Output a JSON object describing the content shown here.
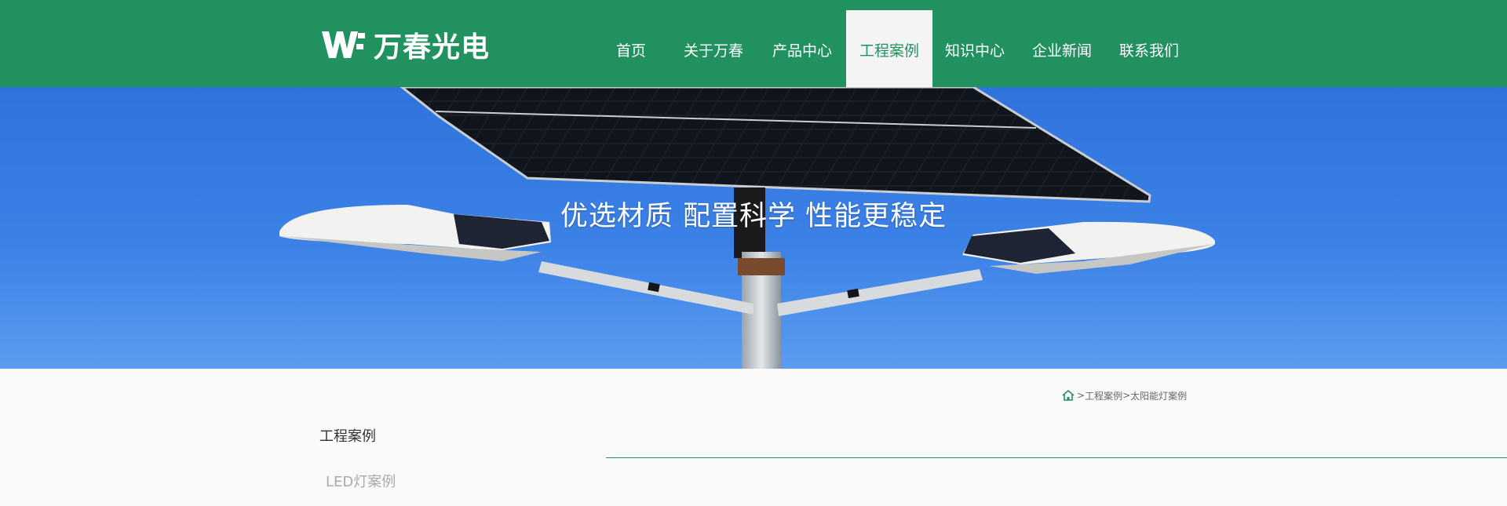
{
  "header": {
    "logo_text": "万春光电",
    "nav": [
      {
        "label": "首页"
      },
      {
        "label": "关于万春"
      },
      {
        "label": "产品中心"
      },
      {
        "label": "工程案例"
      },
      {
        "label": "知识中心"
      },
      {
        "label": "企业新闻"
      },
      {
        "label": "联系我们"
      }
    ],
    "active_nav": "工程案例"
  },
  "banner": {
    "slogan": "优选材质  配置科学  性能更稳定"
  },
  "breadcrumb": {
    "home_icon": "home-icon",
    "separator": ">",
    "level1": "工程案例",
    "level2": "太阳能灯案例"
  },
  "sidebar": {
    "title": "工程案例",
    "items": [
      {
        "label": "LED灯案例"
      }
    ]
  },
  "colors": {
    "brand_green": "#21925f",
    "sky_blue": "#3b81e6",
    "active_tab_bg": "#f4f4f4"
  }
}
